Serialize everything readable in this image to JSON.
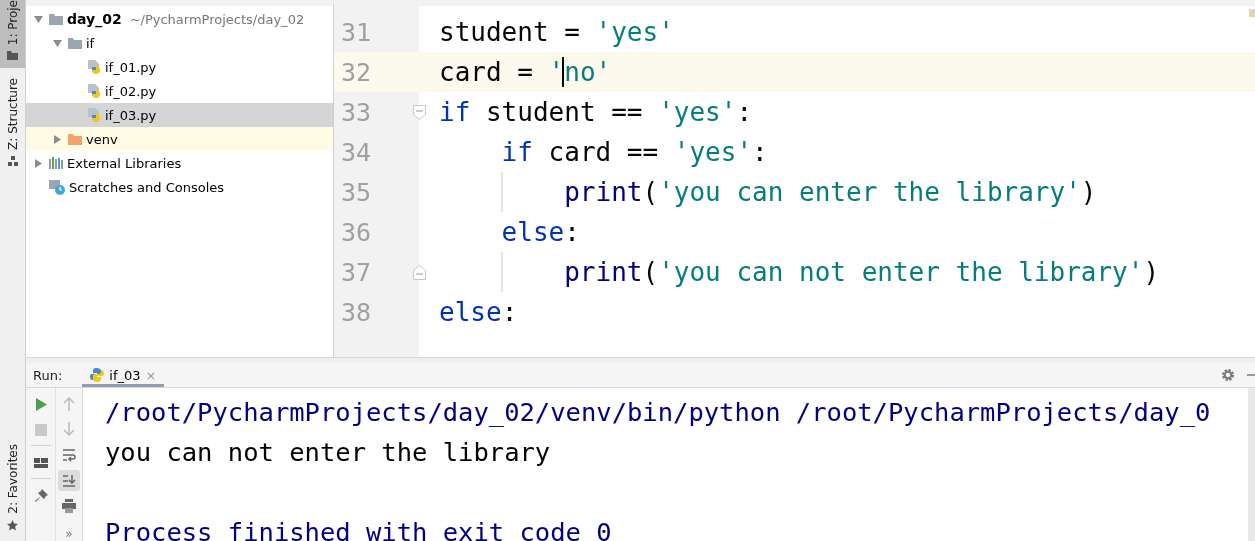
{
  "side_tabs": [
    {
      "label": "1: Proje",
      "kind": "folder",
      "selected": true
    },
    {
      "label": "Z: Structure",
      "kind": "structure",
      "selected": false
    }
  ],
  "bottom_side_tabs": [
    {
      "label": "2: Favorites",
      "kind": "star",
      "selected": false
    }
  ],
  "project_tree": [
    {
      "label": "day_02",
      "path": "~/PycharmProjects/day_02",
      "kind": "folder",
      "expanded": true,
      "selected": false,
      "excluded": false,
      "children": [
        {
          "label": "if",
          "kind": "folder",
          "expanded": true,
          "selected": false,
          "excluded": false,
          "children": [
            {
              "label": "if_01.py",
              "kind": "python",
              "selected": false,
              "excluded": false
            },
            {
              "label": "if_02.py",
              "kind": "python",
              "selected": false,
              "excluded": false
            },
            {
              "label": "if_03.py",
              "kind": "python",
              "selected": true,
              "excluded": false
            }
          ]
        },
        {
          "label": "venv",
          "kind": "excluded_folder",
          "expanded": false,
          "selected": false,
          "excluded": true
        }
      ]
    },
    {
      "label": "External Libraries",
      "kind": "libraries",
      "expanded": false,
      "selected": false,
      "excluded": false
    },
    {
      "label": "Scratches and Consoles",
      "kind": "scratches",
      "selected": false,
      "excluded": false
    }
  ],
  "editor": {
    "lines": [
      {
        "number": "31",
        "current": false,
        "tokens": [
          {
            "text": "student = ",
            "kind": "plain"
          },
          {
            "text": "'yes'",
            "kind": "string"
          }
        ]
      },
      {
        "number": "32",
        "current": true,
        "tokens": [
          {
            "text": "card = ",
            "kind": "plain"
          },
          {
            "text": "'",
            "kind": "string"
          },
          {
            "text": "no'",
            "kind": "string",
            "caret_before": true
          }
        ]
      },
      {
        "number": "33",
        "current": false,
        "fold_start": true,
        "tokens": [
          {
            "text": "if",
            "kind": "keyword"
          },
          {
            "text": " student == ",
            "kind": "plain"
          },
          {
            "text": "'yes'",
            "kind": "string"
          },
          {
            "text": ":",
            "kind": "plain"
          }
        ],
        "children": [
          {
            "number": "34",
            "current": false,
            "tokens": [
              {
                "text": "if",
                "kind": "keyword"
              },
              {
                "text": " card == ",
                "kind": "plain"
              },
              {
                "text": "'yes'",
                "kind": "string"
              },
              {
                "text": ":",
                "kind": "plain"
              }
            ],
            "children": [
              {
                "number": "35",
                "current": false,
                "tokens": [
                  {
                    "text": "print",
                    "kind": "builtin"
                  },
                  {
                    "text": "(",
                    "kind": "plain"
                  },
                  {
                    "text": "'you can enter the library'",
                    "kind": "string"
                  },
                  {
                    "text": ")",
                    "kind": "plain"
                  }
                ]
              }
            ]
          },
          {
            "number": "36",
            "current": false,
            "tokens": [
              {
                "text": "else",
                "kind": "keyword"
              },
              {
                "text": ":",
                "kind": "plain"
              }
            ],
            "children": [
              {
                "number": "37",
                "current": false,
                "fold_end": true,
                "tokens": [
                  {
                    "text": "print",
                    "kind": "builtin"
                  },
                  {
                    "text": "(",
                    "kind": "plain"
                  },
                  {
                    "text": "'you can not enter the library'",
                    "kind": "string"
                  },
                  {
                    "text": ")",
                    "kind": "plain"
                  }
                ]
              }
            ]
          }
        ]
      },
      {
        "number": "38",
        "current": false,
        "tokens": [
          {
            "text": "else",
            "kind": "keyword"
          },
          {
            "text": ":",
            "kind": "plain"
          }
        ]
      }
    ]
  },
  "run_panel": {
    "label": "Run:",
    "tabs": [
      {
        "title": "if_03",
        "close": "×",
        "selected": true
      }
    ],
    "left_tools": [
      {
        "kind": "run",
        "disabled": false
      },
      {
        "kind": "stop",
        "disabled": true
      },
      {
        "kind": "layout",
        "disabled": false
      },
      {
        "kind": "pin",
        "disabled": false
      }
    ],
    "right_tools": [
      {
        "kind": "up",
        "disabled": true,
        "selected": false
      },
      {
        "kind": "down",
        "disabled": true,
        "selected": false
      },
      {
        "kind": "wrap",
        "disabled": false,
        "selected": false
      },
      {
        "kind": "scroll_end",
        "disabled": false,
        "selected": true
      },
      {
        "kind": "print",
        "disabled": false,
        "selected": false
      }
    ],
    "more": "»",
    "console": [
      {
        "kind": "command",
        "text": "/root/PycharmProjects/day_02/venv/bin/python /root/PycharmProjects/day_0"
      },
      {
        "kind": "output",
        "text": "you can not enter the library"
      },
      {
        "kind": "blank"
      },
      {
        "kind": "system",
        "text": "Process finished with exit code 0"
      }
    ]
  }
}
